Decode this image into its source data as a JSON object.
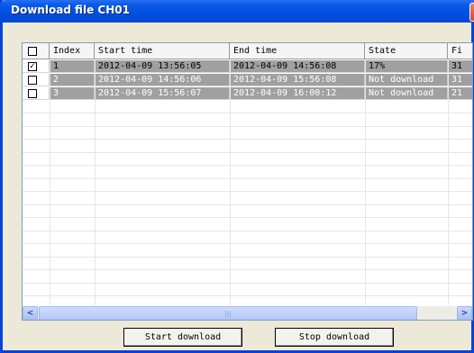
{
  "window": {
    "title": "Download file CH01",
    "close_glyph": "✕"
  },
  "table": {
    "headers": {
      "index": "Index",
      "start": "Start time",
      "end": "End time",
      "state": "State",
      "file": "Fi"
    },
    "rows": [
      {
        "checked": true,
        "index": "1",
        "start": "2012-04-09 13:56:05",
        "end": "2012-04-09 14:56:08",
        "state": "17%",
        "file": "31"
      },
      {
        "checked": false,
        "index": "2",
        "start": "2012-04-09 14:56:06",
        "end": "2012-04-09 15:56:08",
        "state": "Not download",
        "file": "31"
      },
      {
        "checked": false,
        "index": "3",
        "start": "2012-04-09 15:56:07",
        "end": "2012-04-09 16:00:12",
        "state": "Not download",
        "file": "21"
      }
    ],
    "check_glyph": "✓"
  },
  "scrollbar": {
    "left_arrow": "<",
    "right_arrow": ">"
  },
  "buttons": {
    "start": "Start download",
    "stop": "Stop download"
  }
}
